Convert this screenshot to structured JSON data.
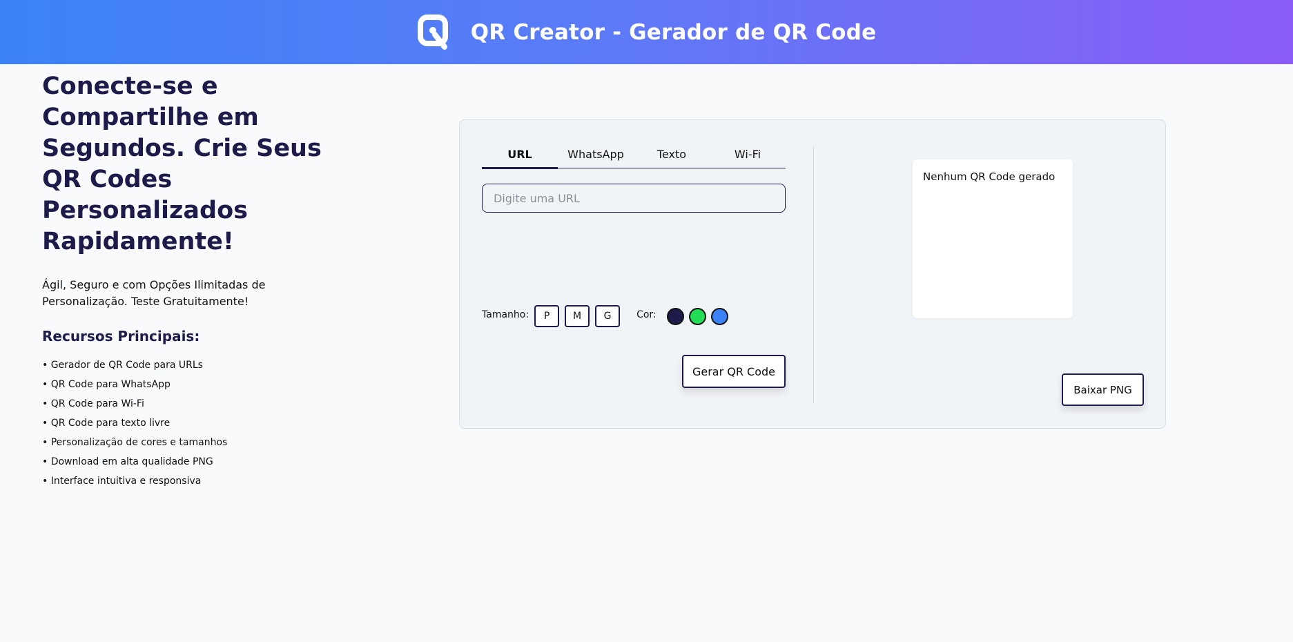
{
  "header": {
    "title": "QR Creator - Gerador de QR Code",
    "logo_icon": "qr-logo-icon",
    "gradient": [
      "#3b82f6",
      "#8b5cf6"
    ]
  },
  "hero": {
    "title": "Conecte-se e Compartilhe em Segundos. Crie Seus QR Codes Personalizados Rapidamente!",
    "subtitle": "Ágil, Seguro e com Opções Ilimitadas de Personalização. Teste Gratuitamente!"
  },
  "features": {
    "title": "Recursos Principais:",
    "items": [
      "• Gerador de QR Code para URLs",
      "• QR Code para WhatsApp",
      "• QR Code para Wi-Fi",
      "• QR Code para texto livre",
      "• Personalização de cores e tamanhos",
      "• Download em alta qualidade PNG",
      "• Interface intuitiva e responsiva"
    ]
  },
  "generator": {
    "tabs": [
      {
        "label": "URL",
        "active": true
      },
      {
        "label": "WhatsApp",
        "active": false
      },
      {
        "label": "Texto",
        "active": false
      },
      {
        "label": "Wi-Fi",
        "active": false
      }
    ],
    "url_input": {
      "value": "",
      "placeholder": "Digite uma URL"
    },
    "size_label": "Tamanho:",
    "sizes": [
      "P",
      "M",
      "G"
    ],
    "color_label": "Cor:",
    "colors": [
      "#1e1b4b",
      "#22dd55",
      "#3b82f6"
    ],
    "generate_label": "Gerar QR Code"
  },
  "preview": {
    "empty_text": "Nenhum QR Code gerado",
    "download_label": "Baixar PNG"
  }
}
